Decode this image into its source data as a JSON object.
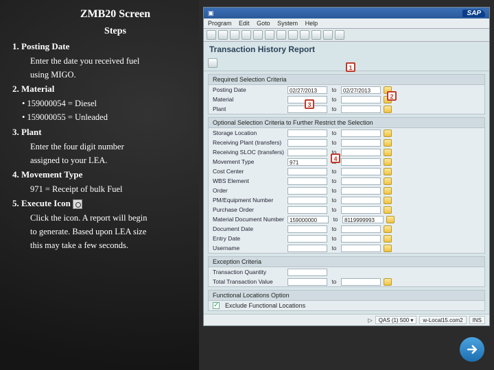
{
  "title": "ZMB20 Screen",
  "subtitle": "Steps",
  "steps": {
    "s1": {
      "h": "1.  Posting Date",
      "l1": "Enter the date you received fuel",
      "l2": "using MIGO."
    },
    "s2": {
      "h": "2.  Material",
      "b1": "•    159000054 = Diesel",
      "b2": "•    159000055 = Unleaded"
    },
    "s3": {
      "h": "3.  Plant",
      "l1": "Enter the four digit number",
      "l2": "assigned to your LEA."
    },
    "s4": {
      "h": "4.  Movement Type",
      "l1": "971 = Receipt of bulk Fuel"
    },
    "s5": {
      "h": "5.  Execute Icon",
      "l1": "Click the icon.  A report will begin",
      "l2": "to generate.  Based upon LEA size",
      "l3": "this may take a few seconds."
    }
  },
  "sap": {
    "menus": {
      "m1": "Program",
      "m2": "Edit",
      "m3": "Goto",
      "m4": "System",
      "m5": "Help"
    },
    "header": "Transaction History Report",
    "panel_req": "Required Selection Criteria",
    "panel_opt": "Optional Selection Criteria to Further Restrict the Selection",
    "panel_exc": "Exception Criteria",
    "panel_fun": "Functional Locations Option",
    "labels": {
      "posting": "Posting Date",
      "material": "Material",
      "plant": "Plant",
      "sloc": "Storage Location",
      "rplant": "Receiving Plant (transfers)",
      "rsloc": "Receiving SLOC (transfers)",
      "mvt": "Movement Type",
      "cc": "Cost Center",
      "wbs": "WBS Element",
      "order": "Order",
      "pmeq": "PM/Equipment Number",
      "po": "Purchase Order",
      "matdoc": "Material Document Number",
      "docdate": "Document Date",
      "entry": "Entry Date",
      "user": "Username",
      "trq": "Transaction Quantity",
      "trv": "Total Transaction Value",
      "excl": "Exclude Functional Locations"
    },
    "values": {
      "posting_from": "02/27/2013",
      "posting_to": "02/27/2013",
      "mvt_from": "971",
      "matdoc_from": "159000000",
      "matdoc_to": "8119999993"
    },
    "to": "to",
    "callouts": {
      "c1": "1",
      "c2": "2",
      "c3": "3",
      "c4": "4"
    },
    "footer": {
      "a": "QAS (1) 500 ▾",
      "b": "w-Local15.com2",
      "c": "INS"
    }
  }
}
